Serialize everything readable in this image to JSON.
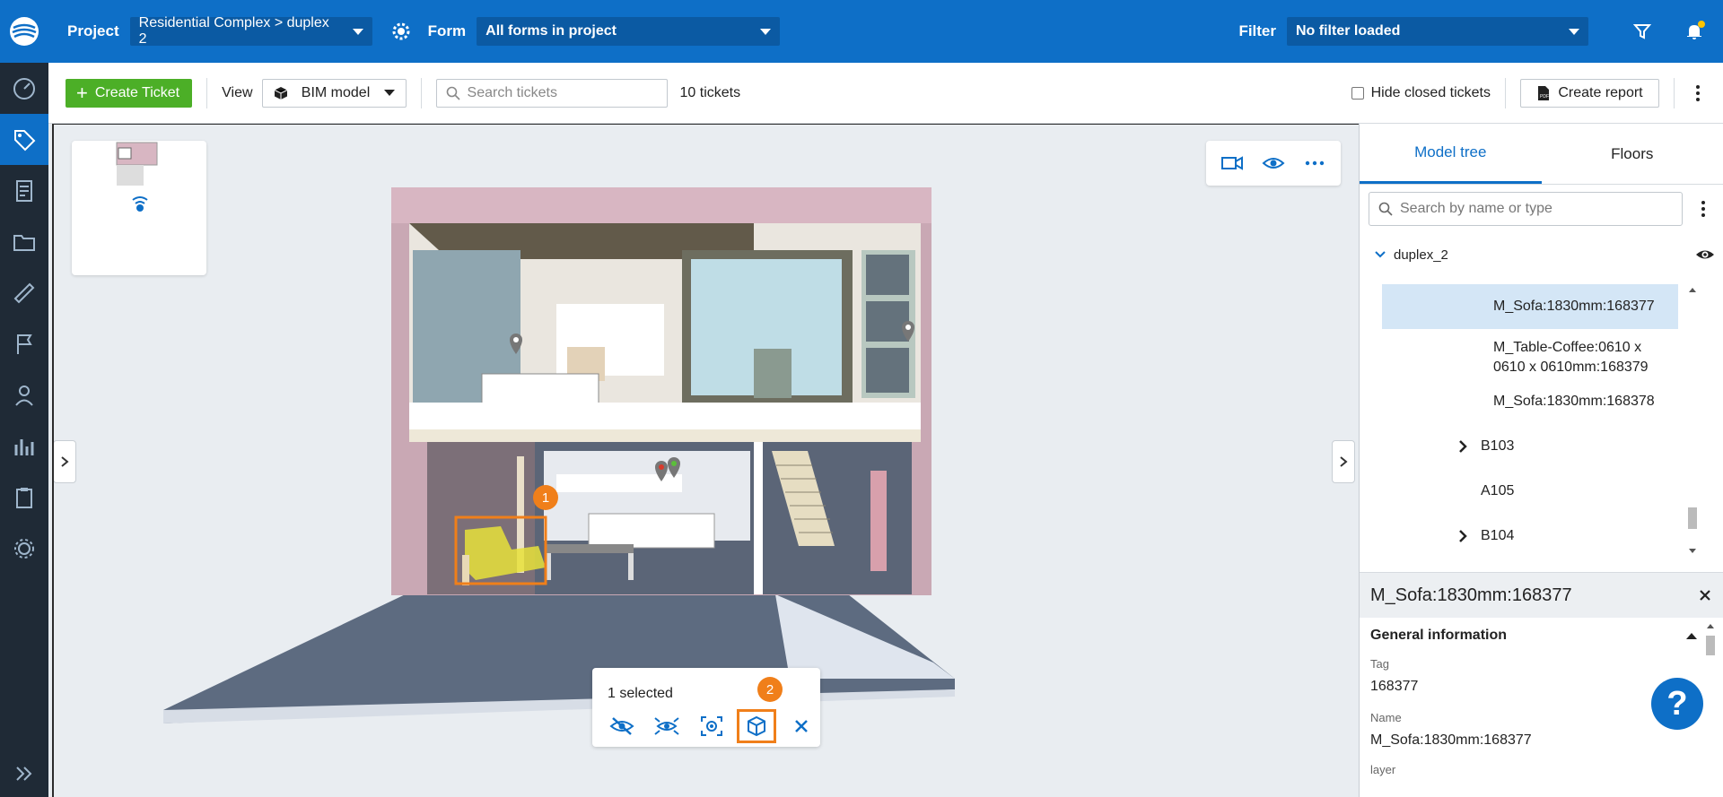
{
  "topbar": {
    "project_label": "Project",
    "project_value": "Residential Complex > duplex 2",
    "form_label": "Form",
    "form_value": "All forms in project",
    "filter_label": "Filter",
    "filter_value": "No filter loaded"
  },
  "toolbar": {
    "create_ticket": "Create Ticket",
    "view_label": "View",
    "view_value": "BIM model",
    "search_placeholder": "Search tickets",
    "ticket_count": "10 tickets",
    "hide_closed": "Hide closed tickets",
    "create_report": "Create report"
  },
  "viewer": {
    "selection_count": "1 selected",
    "badge_1": "1",
    "badge_2": "2"
  },
  "rpanel": {
    "tabs": [
      "Model tree",
      "Floors"
    ],
    "search_placeholder": "Search by name or type",
    "root": "duplex_2",
    "items": [
      {
        "label": "M_Sofa:1830mm:168377",
        "selected": true,
        "expandable": false
      },
      {
        "label": "M_Table-Coffee:0610 x 0610 x 0610mm:168379",
        "selected": false,
        "expandable": false
      },
      {
        "label": "M_Sofa:1830mm:168378",
        "selected": false,
        "expandable": false
      },
      {
        "label": "B103",
        "selected": false,
        "expandable": true
      },
      {
        "label": "A105",
        "selected": false,
        "expandable": false
      },
      {
        "label": "B104",
        "selected": false,
        "expandable": true
      }
    ]
  },
  "props": {
    "title": "M_Sofa:1830mm:168377",
    "section": "General information",
    "fields": [
      {
        "key": "Tag",
        "value": "168377"
      },
      {
        "key": "Name",
        "value": "M_Sofa:1830mm:168377"
      },
      {
        "key": "layer",
        "value": ""
      }
    ]
  },
  "colors": {
    "brand": "#0e6fc7",
    "nav_bg": "#1f2a36",
    "accent_green": "#4caf27",
    "highlight_orange": "#f07f1a"
  }
}
